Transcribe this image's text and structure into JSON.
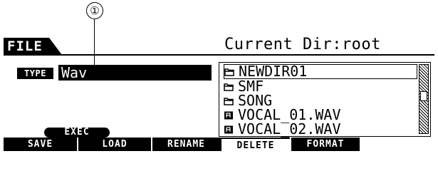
{
  "callout": {
    "number": "①"
  },
  "header": {
    "title": "FILE",
    "current_dir": "Current Dir:root"
  },
  "type_field": {
    "label": "TYPE",
    "value": "Wav"
  },
  "file_list": {
    "items": [
      {
        "name": "NEWDIR01",
        "icon": "folder-icon",
        "selected": true
      },
      {
        "name": "SMF",
        "icon": "folder-icon",
        "selected": false
      },
      {
        "name": "SONG",
        "icon": "folder-icon",
        "selected": false
      },
      {
        "name": "VOCAL_01.WAV",
        "icon": "audio-file-icon",
        "selected": false
      },
      {
        "name": "VOCAL_02.WAV",
        "icon": "audio-file-icon",
        "selected": false
      }
    ]
  },
  "exec_button": {
    "label": "EXEC"
  },
  "function_buttons": [
    {
      "label": "SAVE"
    },
    {
      "label": "LOAD"
    },
    {
      "label": "RENAME"
    },
    {
      "label": "DELETE"
    },
    {
      "label": "FORMAT"
    }
  ]
}
